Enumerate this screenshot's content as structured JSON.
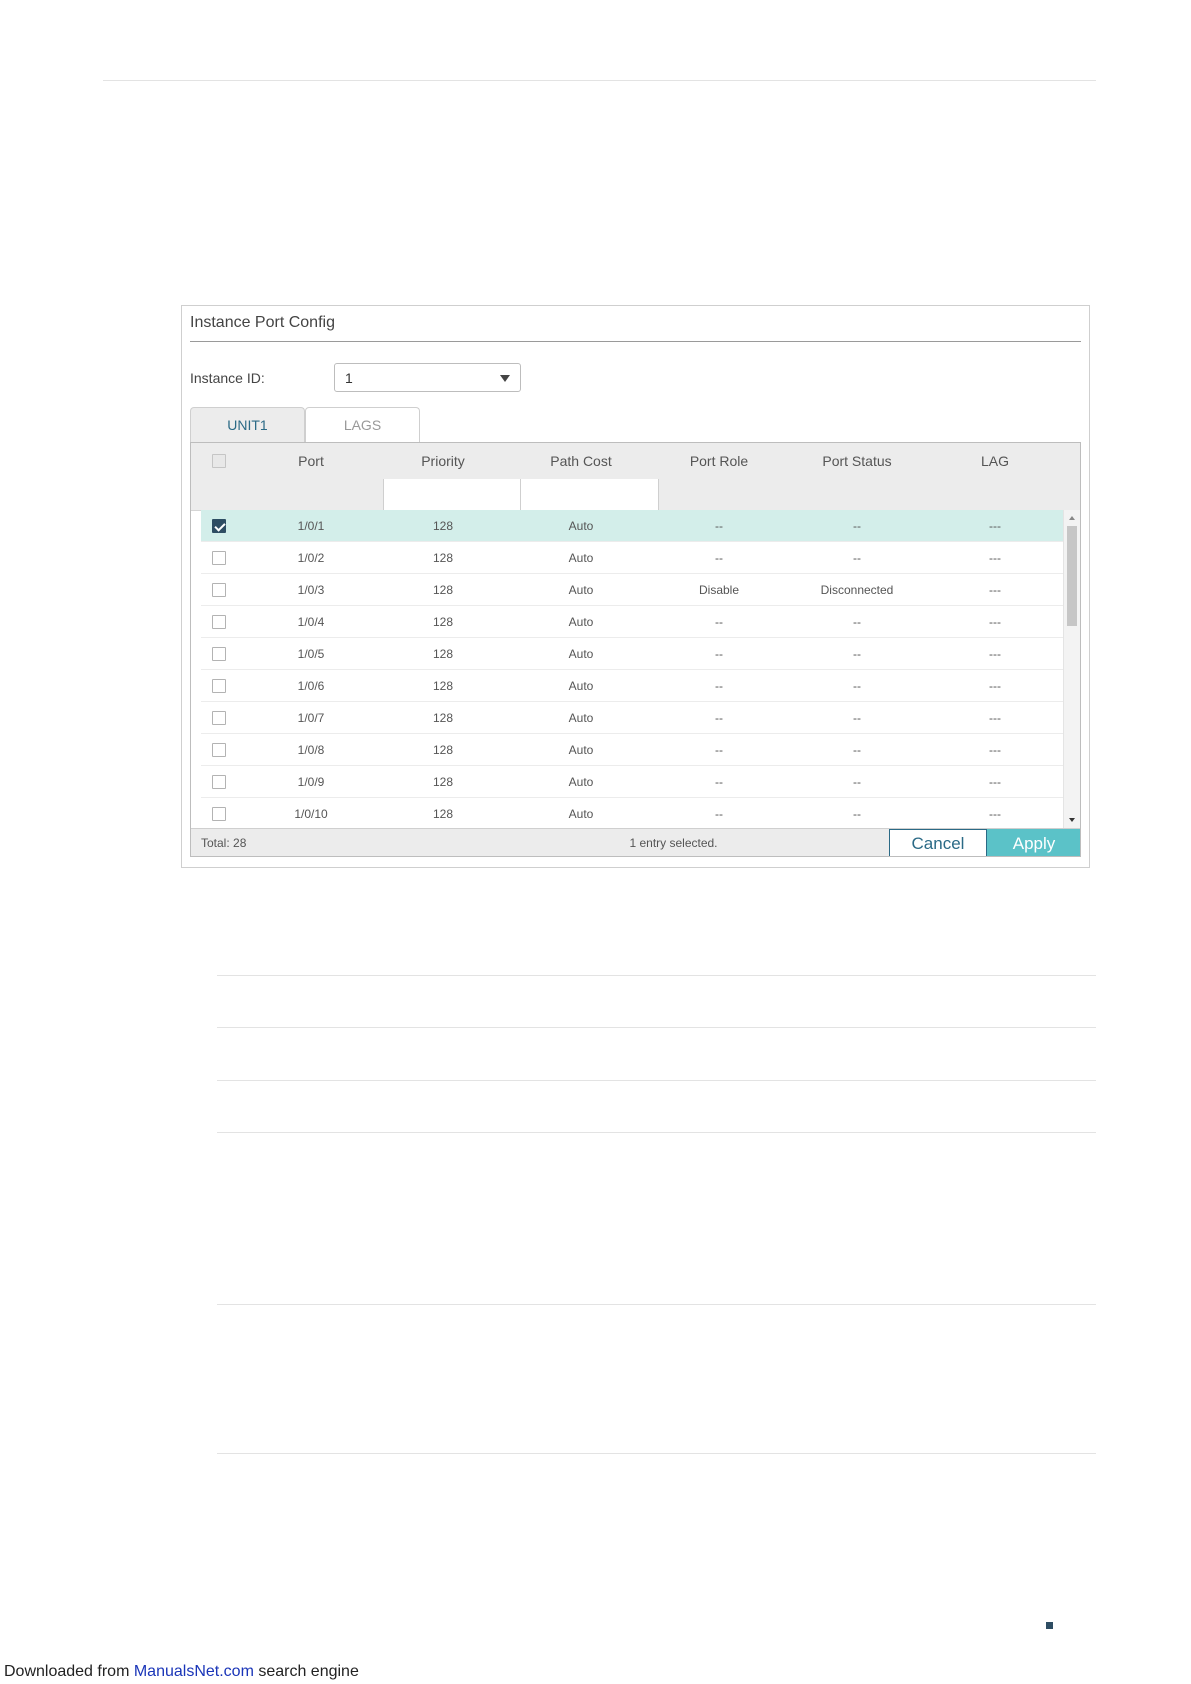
{
  "panel": {
    "title": "Instance Port Config",
    "instance_label": "Instance ID:",
    "instance_value": "1",
    "tabs": [
      {
        "label": "UNIT1",
        "active": true
      },
      {
        "label": "LAGS",
        "active": false
      }
    ]
  },
  "table": {
    "headers": {
      "port": "Port",
      "priority": "Priority",
      "path_cost": "Path Cost",
      "port_role": "Port Role",
      "port_status": "Port Status",
      "lag": "LAG"
    },
    "rows": [
      {
        "checked": true,
        "port": "1/0/1",
        "priority": "128",
        "path_cost": "Auto",
        "port_role": "--",
        "port_status": "--",
        "lag": "---"
      },
      {
        "checked": false,
        "port": "1/0/2",
        "priority": "128",
        "path_cost": "Auto",
        "port_role": "--",
        "port_status": "--",
        "lag": "---"
      },
      {
        "checked": false,
        "port": "1/0/3",
        "priority": "128",
        "path_cost": "Auto",
        "port_role": "Disable",
        "port_status": "Disconnected",
        "lag": "---"
      },
      {
        "checked": false,
        "port": "1/0/4",
        "priority": "128",
        "path_cost": "Auto",
        "port_role": "--",
        "port_status": "--",
        "lag": "---"
      },
      {
        "checked": false,
        "port": "1/0/5",
        "priority": "128",
        "path_cost": "Auto",
        "port_role": "--",
        "port_status": "--",
        "lag": "---"
      },
      {
        "checked": false,
        "port": "1/0/6",
        "priority": "128",
        "path_cost": "Auto",
        "port_role": "--",
        "port_status": "--",
        "lag": "---"
      },
      {
        "checked": false,
        "port": "1/0/7",
        "priority": "128",
        "path_cost": "Auto",
        "port_role": "--",
        "port_status": "--",
        "lag": "---"
      },
      {
        "checked": false,
        "port": "1/0/8",
        "priority": "128",
        "path_cost": "Auto",
        "port_role": "--",
        "port_status": "--",
        "lag": "---"
      },
      {
        "checked": false,
        "port": "1/0/9",
        "priority": "128",
        "path_cost": "Auto",
        "port_role": "--",
        "port_status": "--",
        "lag": "---"
      },
      {
        "checked": false,
        "port": "1/0/10",
        "priority": "128",
        "path_cost": "Auto",
        "port_role": "--",
        "port_status": "--",
        "lag": "---"
      }
    ],
    "total": "Total: 28",
    "selection_status": "1 entry selected.",
    "cancel_label": "Cancel",
    "apply_label": "Apply"
  },
  "footer": {
    "prefix": "Downloaded from ",
    "link": "ManualsNet.com",
    "suffix": " search engine"
  },
  "colors": {
    "accent": "#2b6a86",
    "apply_button": "#5bc2c8",
    "selected_row": "#d3eeea",
    "checkbox_checked": "#2e4d63"
  }
}
